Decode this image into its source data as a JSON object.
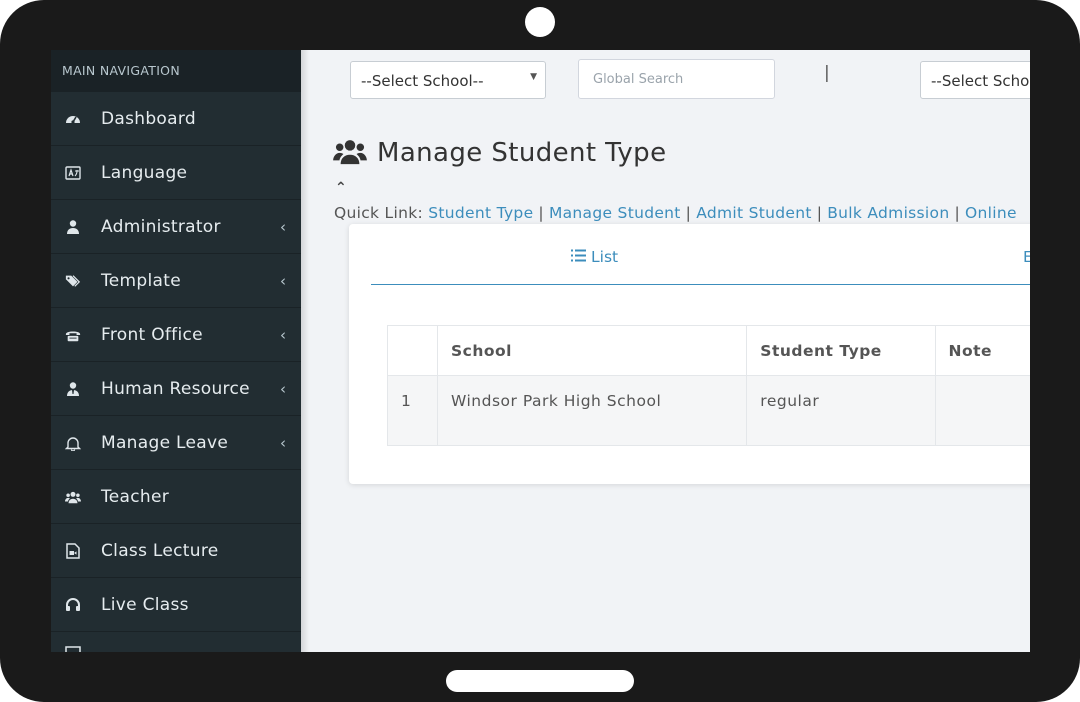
{
  "sidebar": {
    "header": "MAIN NAVIGATION",
    "items": [
      {
        "label": "Dashboard",
        "icon": "dashboard-icon",
        "chevron": ""
      },
      {
        "label": "Language",
        "icon": "language-icon",
        "chevron": ""
      },
      {
        "label": "Administrator",
        "icon": "user-icon",
        "chevron": "‹"
      },
      {
        "label": "Template",
        "icon": "tags-icon",
        "chevron": "‹"
      },
      {
        "label": "Front Office",
        "icon": "fax-icon",
        "chevron": "‹"
      },
      {
        "label": "Human Resource",
        "icon": "user-tie-icon",
        "chevron": "‹"
      },
      {
        "label": "Manage Leave",
        "icon": "bell-icon",
        "chevron": "‹"
      },
      {
        "label": "Teacher",
        "icon": "users-icon",
        "chevron": ""
      },
      {
        "label": "Class Lecture",
        "icon": "file-video-icon",
        "chevron": ""
      },
      {
        "label": "Live Class",
        "icon": "headphones-icon",
        "chevron": ""
      }
    ]
  },
  "topbar": {
    "school_select": "--Select School--",
    "search_placeholder": "Global Search",
    "divider": "|",
    "school_select_2": "--Select Scho"
  },
  "page": {
    "title": "Manage Student Type",
    "collapse": "⌃",
    "quick_link_label": "Quick Link:",
    "quick_links": [
      "Student Type",
      "Manage Student",
      "Admit Student",
      "Bulk Admission",
      "Online"
    ],
    "separator": "|"
  },
  "tabs": {
    "list_label": "List",
    "add_label": "E"
  },
  "table": {
    "headers": [
      "",
      "School",
      "Student Type",
      "Note"
    ],
    "rows": [
      [
        "1",
        "Windsor Park High School",
        "regular",
        ""
      ]
    ]
  },
  "colors": {
    "sidebar_bg": "#222d32",
    "link": "#3c8dbc",
    "frame": "#1a1a1a"
  }
}
